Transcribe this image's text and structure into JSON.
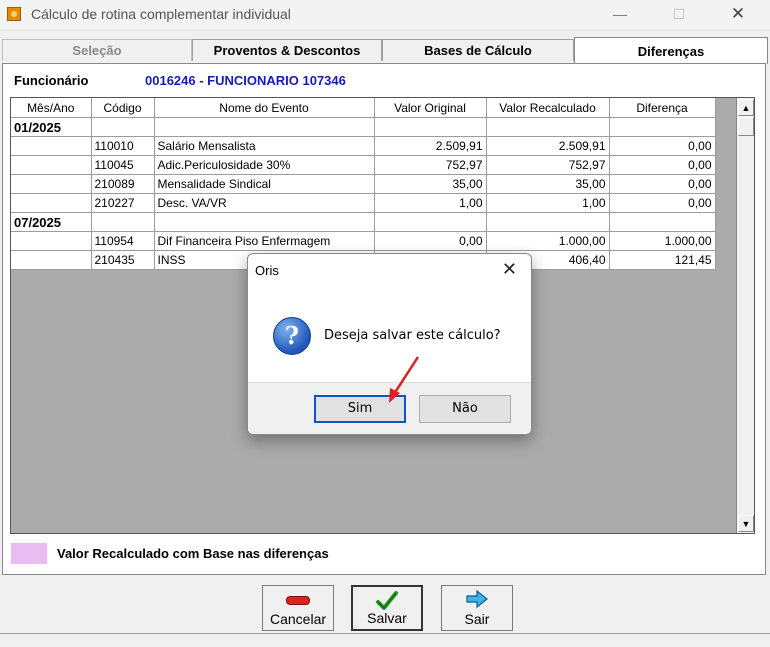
{
  "window": {
    "title": "Cálculo de rotina complementar individual",
    "minimize": "—",
    "maximize": "☐",
    "close": "✕"
  },
  "tabs": [
    {
      "label": "Seleção"
    },
    {
      "label": "Proventos & Descontos"
    },
    {
      "label": "Bases de Cálculo"
    },
    {
      "label": "Diferenças"
    }
  ],
  "employee": {
    "label": "Funcionário",
    "value": "0016246 - FUNCIONARIO 107346"
  },
  "grid": {
    "columns": [
      "Mês/Ano",
      "Código",
      "Nome do Evento",
      "Valor Original",
      "Valor Recalculado",
      "Diferença"
    ],
    "rows": [
      {
        "month": "01/2025",
        "code": "",
        "name": "",
        "orig": "",
        "recalc": "",
        "diff": ""
      },
      {
        "month": "",
        "code": "110010",
        "name": "Salário Mensalista",
        "orig": "2.509,91",
        "recalc": "2.509,91",
        "diff": "0,00"
      },
      {
        "month": "",
        "code": "110045",
        "name": "Adic.Periculosidade 30%",
        "orig": "752,97",
        "recalc": "752,97",
        "diff": "0,00"
      },
      {
        "month": "",
        "code": "210089",
        "name": "Mensalidade Sindical",
        "orig": "35,00",
        "recalc": "35,00",
        "diff": "0,00"
      },
      {
        "month": "",
        "code": "210227",
        "name": "Desc. VA/VR",
        "orig": "1,00",
        "recalc": "1,00",
        "diff": "0,00"
      },
      {
        "month": "07/2025",
        "code": "",
        "name": "",
        "orig": "",
        "recalc": "",
        "diff": ""
      },
      {
        "month": "",
        "code": "110954",
        "name": "Dif Financeira Piso Enfermagem",
        "orig": "0,00",
        "recalc": "1.000,00",
        "diff": "1.000,00"
      },
      {
        "month": "",
        "code": "210435",
        "name": "INSS",
        "orig": "",
        "recalc": "406,40",
        "diff": "121,45"
      }
    ]
  },
  "legend": {
    "text": "Valor Recalculado com Base nas diferenças",
    "color": "#e9bdf2"
  },
  "toolbar": {
    "cancel_label": "Cancelar",
    "save_label": "Salvar",
    "exit_label": "Sair",
    "cancel_icon": "minus-icon",
    "save_icon": "checkmark-icon",
    "exit_icon": "arrow-right-icon"
  },
  "dialog": {
    "title": "Oris",
    "close": "✕",
    "icon": "question-icon",
    "message": "Deseja salvar este cálculo?",
    "yes_label": "Sim",
    "no_label": "Não"
  },
  "annotation": {
    "arrow_color": "#e02020"
  }
}
